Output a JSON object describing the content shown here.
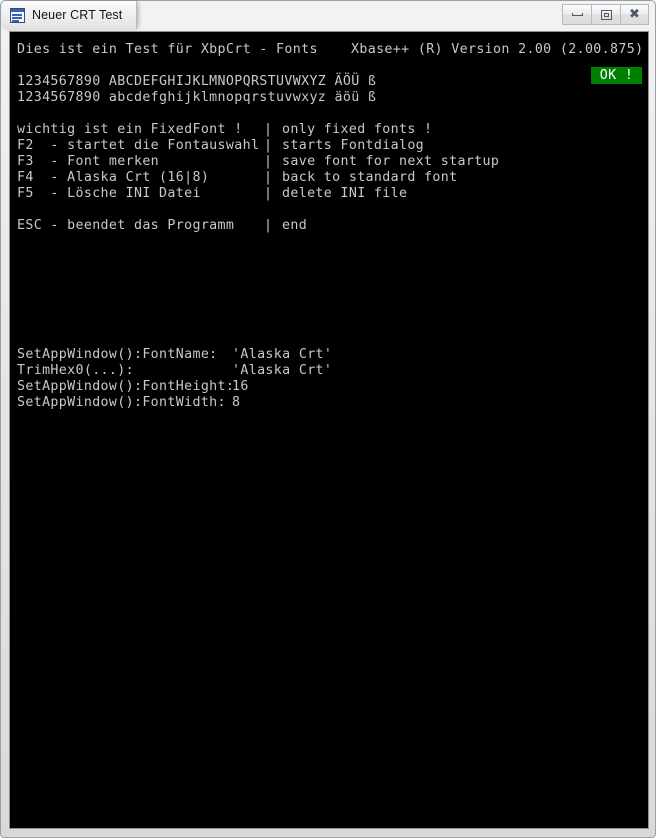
{
  "window": {
    "title": "Neuer CRT Test",
    "icon": "window-document-icon",
    "buttons": {
      "minimize": "minimize-icon",
      "maximize": "maximize-icon",
      "close": "close-icon"
    }
  },
  "console": {
    "background_color": "#000000",
    "text_color": "#c8c8c8",
    "header_left": "Dies ist ein Test für XbpCrt - Fonts",
    "header_right": "Xbase++ (R) Version 2.00 (2.00.875)",
    "charset_upper": "1234567890 ABCDEFGHIJKLMNOPQRSTUVWXYZ ÄÖÜ ß",
    "charset_lower": "1234567890 abcdefghijklmnopqrstuvwxyz äöü ß",
    "help_rows": [
      {
        "left": "wichtig ist ein FixedFont !",
        "sep": "|",
        "right": "only fixed fonts !"
      },
      {
        "left": "F2  - startet die Fontauswahl",
        "sep": "|",
        "right": "starts Fontdialog"
      },
      {
        "left": "F3  - Font merken",
        "sep": "|",
        "right": "save font for next startup"
      },
      {
        "left": "F4  - Alaska Crt (16|8)",
        "sep": "|",
        "right": "back to standard font"
      },
      {
        "left": "F5  - Lösche INI Datei",
        "sep": "|",
        "right": "delete INI file"
      }
    ],
    "exit_row": {
      "left": "ESC - beendet das Programm",
      "sep": "|",
      "right": "end"
    },
    "status_rows": [
      {
        "label": "SetAppWindow():FontName:",
        "value": "'Alaska Crt'"
      },
      {
        "label": "TrimHex0(...):",
        "value": "'Alaska Crt'"
      },
      {
        "label": "SetAppWindow():FontHeight:",
        "value": "16"
      },
      {
        "label": "SetAppWindow():FontWidth:",
        "value": "8"
      }
    ],
    "ok_badge": {
      "label": "OK !",
      "background_color": "#008000",
      "text_color": "#ffffff"
    }
  }
}
